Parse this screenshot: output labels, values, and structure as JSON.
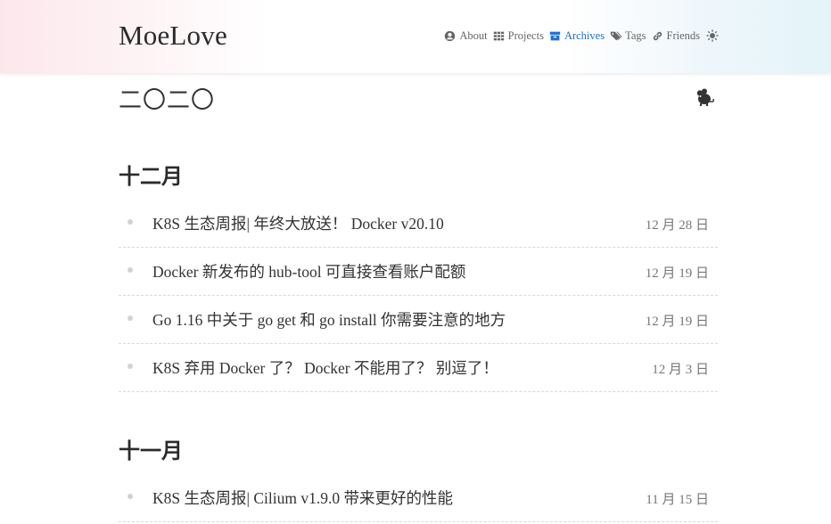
{
  "brand": "MoeLove",
  "nav": [
    {
      "label": "About",
      "icon": "user-circle-icon",
      "active": false
    },
    {
      "label": "Projects",
      "icon": "grid-icon",
      "active": false
    },
    {
      "label": "Archives",
      "icon": "archive-icon",
      "active": true
    },
    {
      "label": "Tags",
      "icon": "tags-icon",
      "active": false
    },
    {
      "label": "Friends",
      "icon": "link-icon",
      "active": false
    }
  ],
  "theme_toggle_icon": "sun-icon",
  "colors": {
    "accent": "#1f6fd6",
    "text": "#333333",
    "muted": "#777777"
  },
  "year": {
    "title": "二〇二〇",
    "icon": "rat-zodiac-icon"
  },
  "months": [
    {
      "title": "十二月",
      "posts": [
        {
          "title": "K8S 生态周报| 年终大放送！ Docker v20.10",
          "date": "12 月 28 日"
        },
        {
          "title": "Docker 新发布的 hub-tool 可直接查看账户配额",
          "date": "12 月 19 日"
        },
        {
          "title": "Go 1.16 中关于 go get 和 go install 你需要注意的地方",
          "date": "12 月 19 日"
        },
        {
          "title": "K8S 弃用 Docker 了？ Docker 不能用了？ 别逗了！",
          "date": "12 月 3 日"
        }
      ]
    },
    {
      "title": "十一月",
      "posts": [
        {
          "title": "K8S 生态周报| Cilium v1.9.0 带来更好的性能",
          "date": "11 月 15 日"
        }
      ]
    }
  ]
}
